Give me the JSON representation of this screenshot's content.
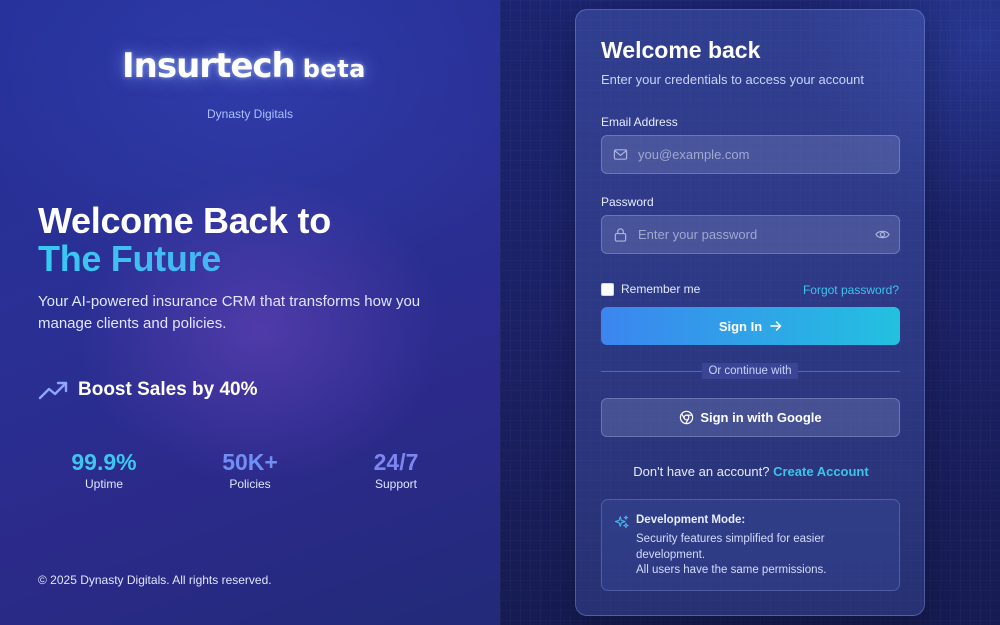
{
  "brand": {
    "name": "Insurtech",
    "tag": "beta",
    "company": "Dynasty Digitals"
  },
  "hero": {
    "title_line1": "Welcome Back to",
    "title_line2": "The Future",
    "subtitle": "Your AI-powered insurance CRM that transforms how you manage clients and policies."
  },
  "highlight": {
    "icon": "trending-up-icon",
    "text": "Boost Sales by 40%"
  },
  "stats": [
    {
      "value": "99.9%",
      "label": "Uptime",
      "color": "#3fc6ef"
    },
    {
      "value": "50K+",
      "label": "Policies",
      "color": "#6f8ff5"
    },
    {
      "value": "24/7",
      "label": "Support",
      "color": "#7d86f0"
    }
  ],
  "footer": {
    "copyright": "© 2025 Dynasty Digitals. All rights reserved."
  },
  "login": {
    "title": "Welcome back",
    "subtitle": "Enter your credentials to access your account",
    "email": {
      "label": "Email Address",
      "placeholder": "you@example.com",
      "value": ""
    },
    "password": {
      "label": "Password",
      "placeholder": "Enter your password",
      "value": ""
    },
    "remember_label": "Remember me",
    "remember_checked": false,
    "forgot_label": "Forgot password?",
    "submit_label": "Sign In",
    "divider_label": "Or continue with",
    "google_label": "Sign in with Google",
    "no_account_text": "Don't have an account?",
    "create_account_label": "Create Account"
  },
  "dev_notice": {
    "title": "Development Mode:",
    "line1": "Security features simplified for easier development.",
    "line2": "All users have the same permissions."
  },
  "colors": {
    "accent": "#3dc3ec",
    "button_start": "#3c85ef",
    "button_end": "#23c1e0"
  }
}
